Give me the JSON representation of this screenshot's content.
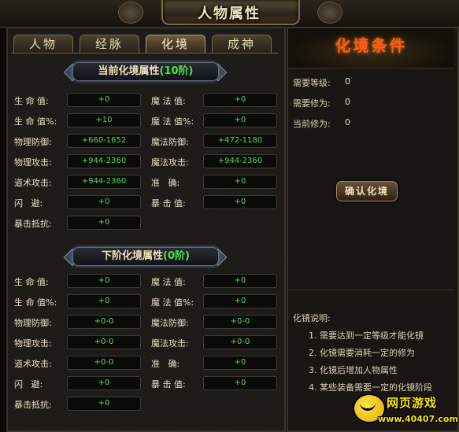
{
  "window": {
    "title": "人物属性"
  },
  "tabs": [
    {
      "label": "人物"
    },
    {
      "label": "经脉"
    },
    {
      "label": "化境",
      "active": true
    },
    {
      "label": "成神"
    }
  ],
  "current": {
    "heading": "当前化境属性",
    "level": "(10阶)",
    "rows": [
      {
        "l1": "生 命 值:",
        "v1": "+0",
        "l2": "魔 法 值:",
        "v2": "+0"
      },
      {
        "l1": "生 命 值%:",
        "v1": "+10",
        "l2": "魔 法 值%:",
        "v2": "+0"
      },
      {
        "l1": "物理防御:",
        "v1": "+660-1652",
        "l2": "魔法防御:",
        "v2": "+472-1180"
      },
      {
        "l1": "物理攻击:",
        "v1": "+944-2360",
        "l2": "魔法攻击:",
        "v2": "+944-2360"
      },
      {
        "l1": "道术攻击:",
        "v1": "+944-2360",
        "l2": "准   确:",
        "v2": "+0"
      },
      {
        "l1": "闪   避:",
        "v1": "+0",
        "l2": "暴 击 值:",
        "v2": "+0"
      },
      {
        "l1": "暴击抵抗:",
        "v1": "+0"
      }
    ]
  },
  "next": {
    "heading": "下阶化境属性",
    "level": "(0阶)",
    "rows": [
      {
        "l1": "生 命 值:",
        "v1": "+0",
        "l2": "魔 法 值:",
        "v2": "+0"
      },
      {
        "l1": "生 命 值%:",
        "v1": "+0",
        "l2": "魔 法 值%:",
        "v2": "+0"
      },
      {
        "l1": "物理防御:",
        "v1": "+0-0",
        "l2": "魔法防御:",
        "v2": "+0-0"
      },
      {
        "l1": "物理攻击:",
        "v1": "+0-0",
        "l2": "魔法攻击:",
        "v2": "+0-0"
      },
      {
        "l1": "道术攻击:",
        "v1": "+0-0",
        "l2": "准   确:",
        "v2": "+0"
      },
      {
        "l1": "闪   避:",
        "v1": "+0",
        "l2": "暴 击 值:",
        "v2": "+0"
      },
      {
        "l1": "暴击抵抗:",
        "v1": "+0"
      }
    ]
  },
  "conditions": {
    "title": "化境条件",
    "items": [
      {
        "label": "需要等级:",
        "value": "0"
      },
      {
        "label": "需要修为:",
        "value": "0"
      },
      {
        "label": "当前修为:",
        "value": "0"
      }
    ],
    "confirm_label": "确认化境",
    "notes_title": "化镜说明:",
    "notes": [
      "1. 需要达到一定等级才能化镜",
      "2. 化镜需要消耗一定的修为",
      "3. 化镜后增加人物属性",
      "4. 某些装备需要一定的化镜阶段"
    ]
  },
  "watermark": {
    "brand": "网页游戏",
    "url": "www.40407.com"
  },
  "colors": {
    "value_green": "#46e046",
    "level_green": "#4be24b",
    "title_orange": "#ff5a1a"
  }
}
